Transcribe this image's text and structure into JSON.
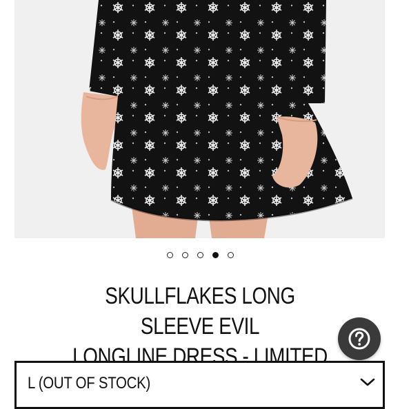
{
  "product": {
    "title_line1": "SKULLFLAKES LONG SLEEVE EVIL",
    "title_line2": "LONGLINE DRESS - LIMITED"
  },
  "carousel": {
    "dot_count": 5,
    "active_index": 3
  },
  "size_select": {
    "selected_value": "L (OUT OF STOCK)"
  },
  "help_button": {
    "icon": "question-mark-icon"
  },
  "colors": {
    "dress": "#121212",
    "skin": "#e7b69d",
    "help_button": "#3a3a3a",
    "active_dot": "#111111"
  }
}
